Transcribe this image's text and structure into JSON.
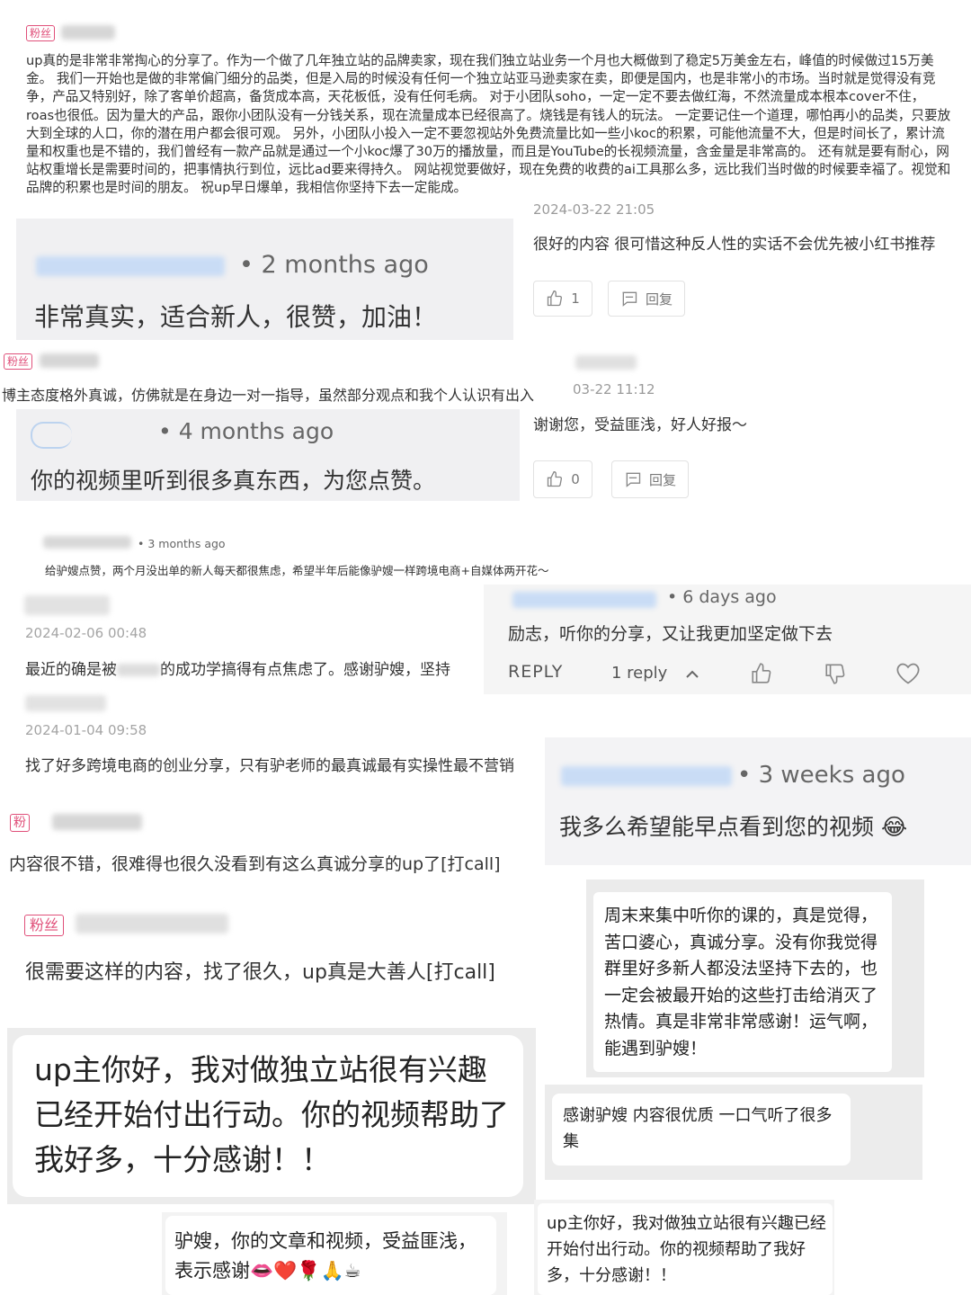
{
  "c1": {
    "badge": "粉丝",
    "text": "up真的是非常非常掏心的分享了。作为一个做了几年独立站的品牌卖家，现在我们独立站业务一个月也大概做到了稳定5万美金左右，峰值的时候做过15万美金。 我们一开始也是做的非常偏门细分的品类，但是入局的时候没有任何一个独立站亚马逊卖家在卖，即便是国内，也是非常小的市场。当时就是觉得没有竞争，产品又特别好，除了客单价超高，备货成本高，天花板低，没有任何毛病。 对于小团队soho，一定一定不要去做红海，不然流量成本根本cover不住，roas也很低。因为量大的产品，跟你小团队没有一分钱关系，现在流量成本已经很高了。烧钱是有钱人的玩法。 一定要记住一个道理，哪怕再小的品类，只要放大到全球的人口，你的潜在用户都会很可观。 另外，小团队小投入一定不要忽视站外免费流量比如一些小koc的积累，可能他流量不大，但是时间长了，累计流量和权重也是不错的，我们曾经有一款产品就是通过一个小koc爆了30万的播放量，而且是YouTube的长视频流量，含金量是非常高的。 还有就是要有耐心，网站权重增长是需要时间的，把事情执行到位，远比ad要来得持久。 网站视觉要做好，现在免费的收费的ai工具那么多，远比我们当时做的时候要幸福了。视觉和品牌的积累也是时间的朋友。 祝up早日爆单，我相信你坚持下去一定能成。"
  },
  "c2": {
    "timestamp": "2024-03-22 21:05",
    "text": "很好的内容 很可惜这种反人性的实话不会优先被小红书推荐",
    "likes": "1",
    "reply": "回复"
  },
  "c3": {
    "time": "• 2 months ago",
    "text": "非常真实，适合新人，很赞，加油！"
  },
  "c4": {
    "badge": "粉丝",
    "text": "博主态度格外真诚，仿佛就是在身边一对一指导，虽然部分观点和我个人认识有出入"
  },
  "c5": {
    "timestamp": "03-22 11:12",
    "text": "谢谢您，受益匪浅，好人好报～",
    "likes": "0",
    "reply": "回复"
  },
  "c6": {
    "time": "• 4 months ago",
    "text": "你的视频里听到很多真东西，为您点赞。"
  },
  "c7": {
    "time": "• 3 months ago",
    "text": "给驴嫂点赞，两个月没出单的新人每天都很焦虑，希望半年后能像驴嫂一样跨境电商+自媒体两开花～"
  },
  "c8": {
    "timestamp": "2024-02-06 00:48",
    "text_a": "最近的确是被",
    "text_b": "的成功学搞得有点焦虑了。感谢驴嫂，坚持"
  },
  "c9": {
    "time": "• 6 days ago",
    "text": "励志，听你的分享，又让我更加坚定做下去",
    "reply_btn": "REPLY",
    "replies": "1 reply"
  },
  "c10": {
    "timestamp": "2024-01-04 09:58",
    "text": "找了好多跨境电商的创业分享，只有驴老师的最真诚最有实操性最不营销"
  },
  "c11": {
    "time": "• 3 weeks ago",
    "text": "我多么希望能早点看到您的视频",
    "emoji": "😂"
  },
  "c12": {
    "badge": "粉",
    "text": "内容很不错，很难得也很久没看到有这么真诚分享的up了[打call]"
  },
  "c13": {
    "badge": "粉丝",
    "text": "很需要这样的内容，找了很久，up真是大善人[打call]"
  },
  "c14": {
    "text": "周末来集中听你的课的，真是觉得，苦口婆心，真诚分享。没有你我觉得群里好多新人都没法坚持下去的，也一定会被最开始的这些打击给消灭了热情。真是非常非常感谢！运气啊，能遇到驴嫂！"
  },
  "c15": {
    "text": "up主你好，我对做独立站很有兴趣已经开始付出行动。你的视频帮助了我好多，十分感谢！！"
  },
  "c16": {
    "text": "感谢驴嫂 内容很优质 一口气听了很多集"
  },
  "c17": {
    "text": "驴嫂，你的文章和视频，受益匪浅，表示感谢",
    "emojis": "👄❤️🌹🙏☕"
  },
  "c18": {
    "text": "up主你好，我对做独立站很有兴趣已经开始付出行动。你的视频帮助了我好多，十分感谢！！"
  },
  "colors": {
    "fan_badge": "#e0507a",
    "blur_name": "#c9dcf5",
    "timestamp": "#9a9a9a"
  }
}
